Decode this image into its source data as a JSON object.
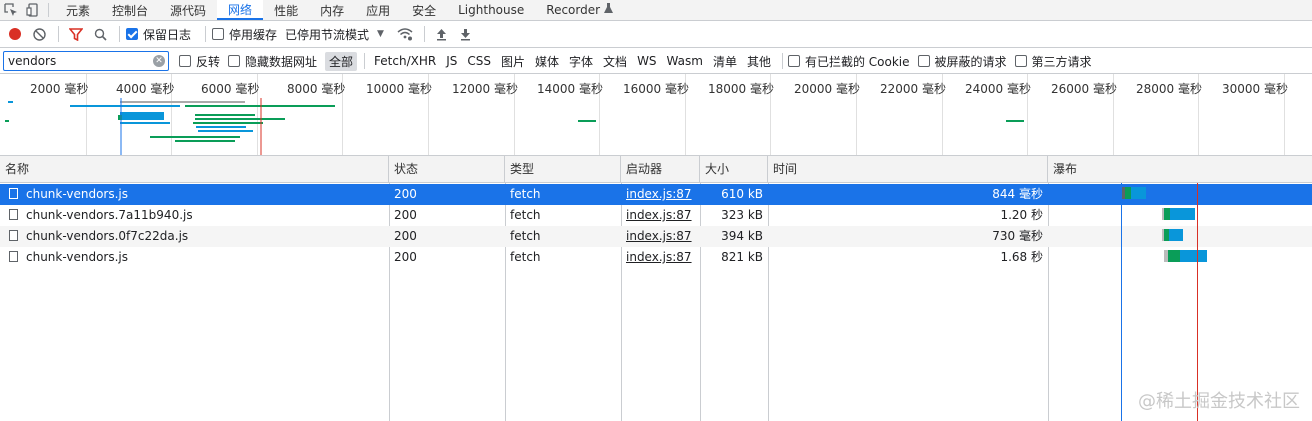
{
  "tabs": [
    "元素",
    "控制台",
    "源代码",
    "网络",
    "性能",
    "内存",
    "应用",
    "安全",
    "Lighthouse",
    "Recorder"
  ],
  "active_tab": "网络",
  "toolbar": {
    "preserve_log": "保留日志",
    "disable_cache": "停用缓存",
    "throttling": "已停用节流模式"
  },
  "filter": {
    "value": "vendors",
    "invert": "反转",
    "hide_data_urls": "隐藏数据网址",
    "types": [
      "全部",
      "Fetch/XHR",
      "JS",
      "CSS",
      "图片",
      "媒体",
      "字体",
      "文档",
      "WS",
      "Wasm",
      "清单",
      "其他"
    ],
    "blocked_cookies": "有已拦截的 Cookie",
    "blocked_requests": "被屏蔽的请求",
    "third_party": "第三方请求"
  },
  "overview": {
    "ticks": [
      "2000 毫秒",
      "4000 毫秒",
      "6000 毫秒",
      "8000 毫秒",
      "10000 毫秒",
      "12000 毫秒",
      "14000 毫秒",
      "16000 毫秒",
      "18000 毫秒",
      "20000 毫秒",
      "22000 毫秒",
      "24000 毫秒",
      "26000 毫秒",
      "28000 毫秒",
      "30000 毫秒"
    ]
  },
  "columns": {
    "name": "名称",
    "status": "状态",
    "type": "类型",
    "initiator": "启动器",
    "size": "大小",
    "time": "时间",
    "waterfall": "瀑布"
  },
  "rows": [
    {
      "name": "chunk-vendors.js",
      "status": "200",
      "type": "fetch",
      "initiator": "index.js:87",
      "size": "610 kB",
      "time": "844 毫秒",
      "selected": true
    },
    {
      "name": "chunk-vendors.7a11b940.js",
      "status": "200",
      "type": "fetch",
      "initiator": "index.js:87",
      "size": "323 kB",
      "time": "1.20 秒",
      "selected": false
    },
    {
      "name": "chunk-vendors.0f7c22da.js",
      "status": "200",
      "type": "fetch",
      "initiator": "index.js:87",
      "size": "394 kB",
      "time": "730 毫秒",
      "selected": false
    },
    {
      "name": "chunk-vendors.js",
      "status": "200",
      "type": "fetch",
      "initiator": "index.js:87",
      "size": "821 kB",
      "time": "1.68 秒",
      "selected": false
    }
  ],
  "watermark": "@稀土掘金技术社区",
  "colors": {
    "accent": "#1a73e8",
    "waiting": "#0a9d58",
    "download": "#0996da",
    "load_line": "#d93025",
    "dom_line": "#1a73e8"
  }
}
